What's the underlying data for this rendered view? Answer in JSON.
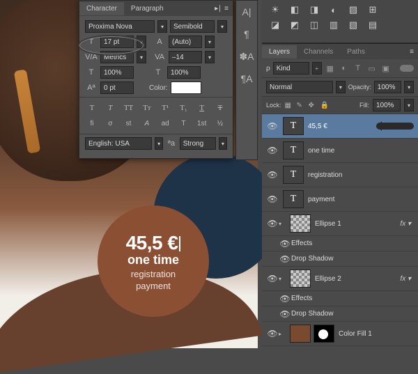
{
  "canvas": {
    "price": "45,5 €",
    "line1": "one time",
    "line2": "registration",
    "line3": "payment"
  },
  "character_panel": {
    "tabs": {
      "character": "Character",
      "paragraph": "Paragraph"
    },
    "font_family": "Proxima Nova",
    "font_style": "Semibold",
    "font_size": "17 pt",
    "leading": "(Auto)",
    "kerning": "Metrics",
    "tracking": "–14",
    "vscale": "100%",
    "hscale": "100%",
    "baseline": "0 pt",
    "color_label": "Color:",
    "language": "English: USA",
    "antialias": "Strong"
  },
  "layers_panel": {
    "tabs": {
      "layers": "Layers",
      "channels": "Channels",
      "paths": "Paths"
    },
    "filter_kind": "Kind",
    "blend_mode": "Normal",
    "opacity_label": "Opacity:",
    "opacity": "100%",
    "lock_label": "Lock:",
    "fill_label": "Fill:",
    "fill": "100%",
    "layers": [
      {
        "name": "45,5 €"
      },
      {
        "name": "one time"
      },
      {
        "name": "registration"
      },
      {
        "name": "payment"
      },
      {
        "name": "Ellipse 1"
      },
      {
        "name": "Effects"
      },
      {
        "name": "Drop Shadow"
      },
      {
        "name": "Ellipse 2"
      },
      {
        "name": "Effects"
      },
      {
        "name": "Drop Shadow"
      },
      {
        "name": "Color Fill 1"
      }
    ]
  }
}
